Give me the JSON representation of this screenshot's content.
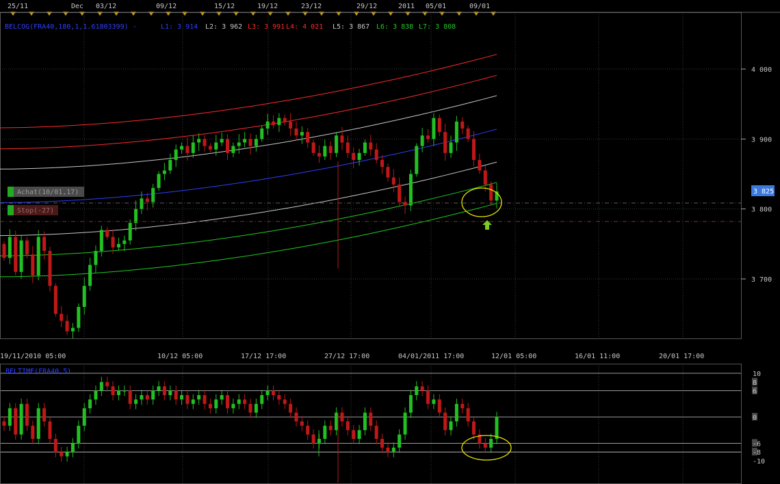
{
  "top_dates": [
    "25/11",
    "Dec",
    "03/12",
    "09/12",
    "15/12",
    "19/12",
    "23/12",
    "29/12",
    "2011",
    "05/01",
    "09/01"
  ],
  "indicator_header": {
    "name": "BELCOG(FRA40,180,1,1.61803399) -",
    "levels": [
      {
        "label": "L1: 3 914",
        "color": "#2f3fff"
      },
      {
        "label": "L2: 3 962",
        "color": "#c8c8c8"
      },
      {
        "label": "L3: 3 991",
        "color": "#ff2a2a"
      },
      {
        "label": "L4: 4 021",
        "color": "#ff2a2a"
      },
      {
        "label": "L5: 3 867",
        "color": "#c8c8c8"
      },
      {
        "label": "L6: 3 838",
        "color": "#22cc22"
      },
      {
        "label": "L7: 3 808",
        "color": "#22cc22"
      }
    ]
  },
  "order_labels": {
    "buy": "Achat(10/01,17)",
    "stop": "Stop(-27)"
  },
  "price_tag": "3 825",
  "price_axis_labels": [
    {
      "v": 4000,
      "t": "4 000"
    },
    {
      "v": 3900,
      "t": "3 900"
    },
    {
      "v": 3800,
      "t": "3 800"
    },
    {
      "v": 3700,
      "t": "3 700"
    }
  ],
  "bottom_date_labels": [
    "19/11/2010 05:00",
    "10/12 05:00",
    "17/12 17:00",
    "27/12 17:00",
    "04/01/2011 17:00",
    "12/01 05:00",
    "16/01 11:00",
    "20/01 17:00"
  ],
  "sub_indicator": {
    "name": "BELTIME(FRA40,5)",
    "axis_labels": [
      {
        "v": 10,
        "t": "10"
      },
      {
        "v": 8,
        "t": "8"
      },
      {
        "v": 6,
        "t": "6"
      },
      {
        "v": 0,
        "t": "0"
      },
      {
        "v": -6,
        "t": "-6"
      },
      {
        "v": -8,
        "t": "-8"
      },
      {
        "v": -10,
        "t": "-10"
      }
    ]
  },
  "colors": {
    "up": "#22c022",
    "down": "#c01818",
    "blue": "#2f3fff",
    "red": "#ff2a2a",
    "white": "#c8c8c8",
    "green": "#22cc22",
    "highlight": "#e8e800"
  },
  "chart_data": {
    "type": "candlestick",
    "price_range": [
      3600,
      4030
    ],
    "bands": [
      {
        "color": "#ff2a2a",
        "start": 3916,
        "end": 4021
      },
      {
        "color": "#ff2a2a",
        "start": 3886,
        "end": 3991
      },
      {
        "color": "#c8c8c8",
        "start": 3857,
        "end": 3962
      },
      {
        "color": "#2f3fff",
        "start": 3809,
        "end": 3914
      },
      {
        "color": "#c8c8c8",
        "start": 3762,
        "end": 3867
      },
      {
        "color": "#22cc22",
        "start": 3733,
        "end": 3838
      },
      {
        "color": "#22cc22",
        "start": 3703,
        "end": 3808
      }
    ],
    "closes": [
      3730,
      3760,
      3710,
      3755,
      3735,
      3705,
      3760,
      3740,
      3690,
      3650,
      3640,
      3625,
      3630,
      3660,
      3690,
      3720,
      3740,
      3770,
      3760,
      3745,
      3750,
      3755,
      3780,
      3800,
      3815,
      3810,
      3830,
      3850,
      3855,
      3870,
      3885,
      3890,
      3880,
      3895,
      3900,
      3890,
      3885,
      3895,
      3900,
      3880,
      3890,
      3895,
      3900,
      3890,
      3900,
      3915,
      3925,
      3920,
      3930,
      3925,
      3915,
      3905,
      3910,
      3895,
      3880,
      3875,
      3890,
      3880,
      3905,
      3895,
      3880,
      3870,
      3880,
      3895,
      3885,
      3870,
      3860,
      3845,
      3835,
      3810,
      3805,
      3850,
      3890,
      3905,
      3900,
      3930,
      3910,
      3880,
      3895,
      3925,
      3915,
      3900,
      3870,
      3855,
      3835,
      3812,
      3825
    ],
    "osc": [
      -2,
      2,
      -4,
      3,
      -2,
      -5,
      2,
      -1,
      -5,
      -8,
      -9,
      -8,
      -6,
      -2,
      2,
      4,
      6,
      8,
      7,
      5,
      6,
      6,
      3,
      4,
      5,
      4,
      6,
      7,
      5,
      6,
      4,
      5,
      3,
      4,
      5,
      3,
      2,
      4,
      5,
      2,
      3,
      4,
      3,
      1,
      3,
      5,
      6,
      5,
      4,
      3,
      1,
      -1,
      -2,
      -4,
      -6,
      -5,
      -2,
      -3,
      1,
      -1,
      -3,
      -5,
      -3,
      1,
      -2,
      -5,
      -7,
      -8,
      -7,
      -4,
      1,
      5,
      7,
      6,
      3,
      4,
      1,
      -3,
      -1,
      3,
      2,
      -1,
      -4,
      -6,
      -7,
      -5,
      0
    ]
  }
}
